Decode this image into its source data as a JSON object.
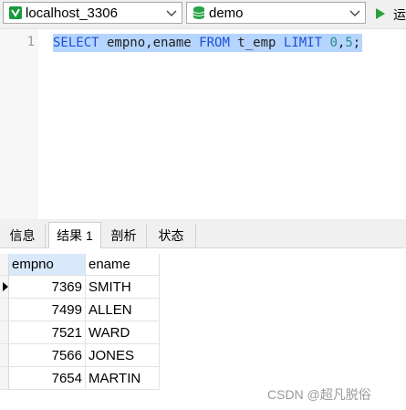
{
  "toolbar": {
    "connection": {
      "value": "localhost_3306",
      "icon": "connection-icon"
    },
    "database": {
      "value": "demo",
      "icon": "database-icon"
    },
    "run_label": "运",
    "colors": {
      "connection_green": "#1a9a3a",
      "db_green": "#2aa148",
      "run_green": "#2aa13a"
    }
  },
  "editor": {
    "line_number": "1",
    "sql": {
      "select": "SELECT",
      "columns": " empno,ename ",
      "from": "FROM",
      "table": " t_emp ",
      "limit": "LIMIT",
      "arg1": " 0",
      "comma": ",",
      "arg2": "5",
      "semicolon": ";"
    },
    "selection_color": "#b5d5ff"
  },
  "tabs": [
    {
      "label": "信息"
    },
    {
      "label": "结果 1",
      "active": true
    },
    {
      "label": "剖析"
    },
    {
      "label": "状态"
    }
  ],
  "grid": {
    "columns": [
      "empno",
      "ename"
    ],
    "rows": [
      {
        "empno": "7369",
        "ename": "SMITH",
        "current": true
      },
      {
        "empno": "7499",
        "ename": "ALLEN"
      },
      {
        "empno": "7521",
        "ename": "WARD"
      },
      {
        "empno": "7566",
        "ename": "JONES"
      },
      {
        "empno": "7654",
        "ename": "MARTIN"
      }
    ]
  },
  "watermark": "CSDN @超凡脱俗"
}
